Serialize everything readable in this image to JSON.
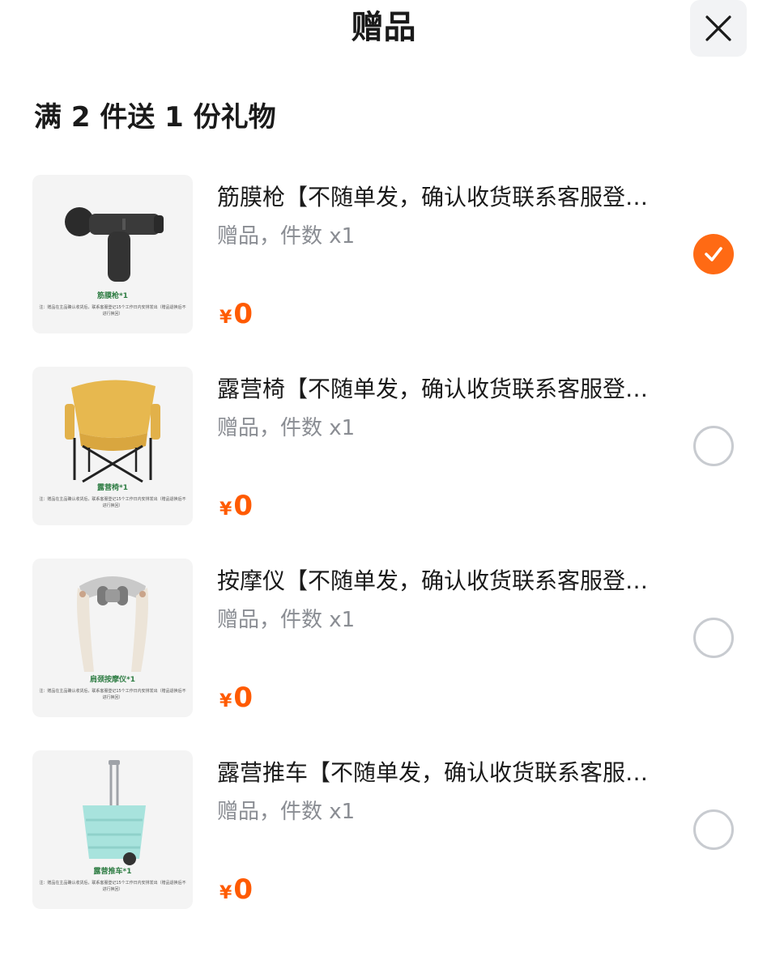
{
  "header": {
    "title": "赠品",
    "close_icon": "close-icon"
  },
  "promo": {
    "text": "满 2 件送 1 份礼物"
  },
  "colors": {
    "accent": "#ff6a14",
    "price": "#ff5a00",
    "subtext": "#8a8d93",
    "radio_border": "#c8cbd0"
  },
  "gifts": [
    {
      "title": "筋膜枪【不随单发，确认收货联系客服登记】",
      "sub": "赠品，件数 x1",
      "yen": "¥",
      "price": "0",
      "selected": true,
      "thumb_caption": "筋膜枪*1",
      "thumb_note": "注：赠品在主品确认收货后，联系客服登记15个工作日内安排发出（赠品退换后不进行换回）",
      "icon": "massage-gun-icon"
    },
    {
      "title": "露营椅【不随单发，确认收货联系客服登记】",
      "sub": "赠品，件数 x1",
      "yen": "¥",
      "price": "0",
      "selected": false,
      "thumb_caption": "露营椅*1",
      "thumb_note": "注：赠品在主品确认收货后，联系客服登记15个工作日内安排发出（赠品退换后不进行换回）",
      "icon": "camping-chair-icon"
    },
    {
      "title": "按摩仪【不随单发，确认收货联系客服登记】",
      "sub": "赠品，件数 x1",
      "yen": "¥",
      "price": "0",
      "selected": false,
      "thumb_caption": "肩颈按摩仪*1",
      "thumb_note": "注：赠品在主品确认收货后，联系客服登记15个工作日内安排发出（赠品退换后不进行换回）",
      "icon": "neck-massager-icon"
    },
    {
      "title": "露营推车【不随单发，确认收货联系客服登记】",
      "sub": "赠品，件数 x1",
      "yen": "¥",
      "price": "0",
      "selected": false,
      "thumb_caption": "露营推车*1",
      "thumb_note": "注：赠品在主品确认收货后，联系客服登记15个工作日内安排发出（赠品退换后不进行换回）",
      "icon": "camping-cart-icon"
    }
  ]
}
